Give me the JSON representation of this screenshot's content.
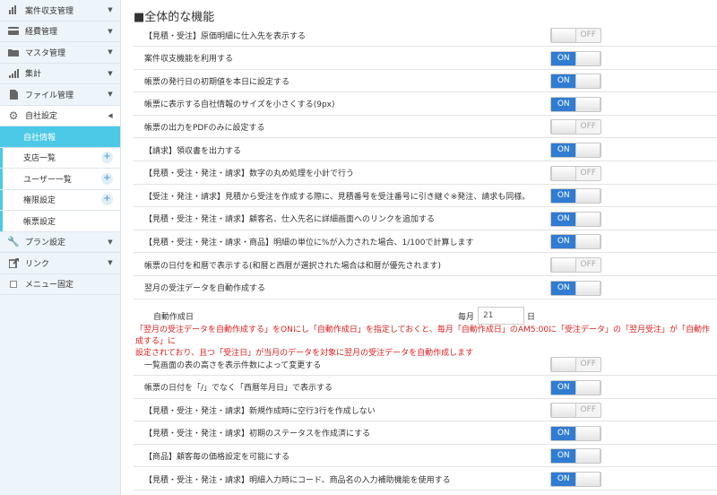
{
  "sidebar": {
    "items": [
      {
        "label": "案件収支管理",
        "icon": "bar-chart-icon"
      },
      {
        "label": "経費管理",
        "icon": "credit-card-icon"
      },
      {
        "label": "マスタ管理",
        "icon": "folder-icon"
      },
      {
        "label": "集計",
        "icon": "signal-icon"
      },
      {
        "label": "ファイル管理",
        "icon": "file-icon"
      },
      {
        "label": "自社設定",
        "icon": "gear-icon"
      }
    ],
    "sub_items": [
      {
        "label": "自社情報"
      },
      {
        "label": "支店一覧"
      },
      {
        "label": "ユーザー一覧"
      },
      {
        "label": "権限設定"
      },
      {
        "label": "帳票設定"
      }
    ],
    "bottom_items": [
      {
        "label": "プラン設定",
        "icon": "wrench-icon"
      },
      {
        "label": "リンク",
        "icon": "external-link-icon"
      },
      {
        "label": "メニュー固定",
        "icon": "checkbox-icon"
      }
    ],
    "accent_color": "#4cc9e6"
  },
  "main": {
    "title": "■全体的な機能",
    "rows": [
      {
        "text": "【見積・受注】原価明細に仕入先を表示する",
        "state": "OFF"
      },
      {
        "text": "案件収支機能を利用する",
        "state": "ON"
      },
      {
        "text": "帳票の発行日の初期値を本日に設定する",
        "state": "ON"
      },
      {
        "text": "帳票に表示する自社情報のサイズを小さくする(9px)",
        "state": "ON"
      },
      {
        "text": "帳票の出力をPDFのみに設定する",
        "state": "OFF"
      },
      {
        "text": "【請求】領収書を出力する",
        "state": "ON"
      },
      {
        "text": "【見積・受注・発注・請求】数字の丸め処理を小計で行う",
        "state": "OFF"
      },
      {
        "text": "【受注・発注・請求】見積から受注を作成する際に、見積番号を受注番号に引き継ぐ※発注、請求も同様。",
        "state": "ON"
      },
      {
        "text": "【見積・受注・発注・請求】顧客名、仕入先名に詳細画面へのリンクを追加する",
        "state": "ON"
      },
      {
        "text": "【見積・受注・発注・請求・商品】明細の単位に%が入力された場合、1/100で計算します",
        "state": "ON"
      },
      {
        "text": "帳票の日付を和暦で表示する(和暦と西暦が選択された場合は和暦が優先されます)",
        "state": "OFF"
      },
      {
        "text": "翌月の受注データを自動作成する",
        "state": "ON"
      }
    ],
    "auto_create": {
      "label": "自動作成日",
      "prefix": "毎月",
      "value": "21",
      "suffix": "日"
    },
    "note_line1": "「翌月の受注データを自動作成する」をONにし「自動作成日」を指定しておくと、毎月「自動作成日」のAM5:00に「受注データ」の「翌月受注」が「自動作成する」に",
    "note_line2": "設定されており、且つ「受注日」が当月のデータを対象に翌月の受注データを自動作成します",
    "rows2": [
      {
        "text": "一覧画面の表の高さを表示件数によって変更する",
        "state": "OFF"
      },
      {
        "text": "帳票の日付を「/」でなく「西暦年月日」で表示する",
        "state": "ON"
      },
      {
        "text": "【見積・受注・発注・請求】新規作成時に空行3行を作成しない",
        "state": "OFF"
      },
      {
        "text": "【見積・受注・発注・請求】初期のステータスを作成済にする",
        "state": "ON"
      },
      {
        "text": "【商品】顧客毎の価格設定を可能にする",
        "state": "ON"
      },
      {
        "text": "【見積・受注・発注・請求】明細入力時にコード、商品名の入力補助機能を使用する",
        "state": "ON"
      }
    ],
    "on_label": "ON",
    "off_label": "OFF",
    "on_color": "#2f7cd2"
  }
}
